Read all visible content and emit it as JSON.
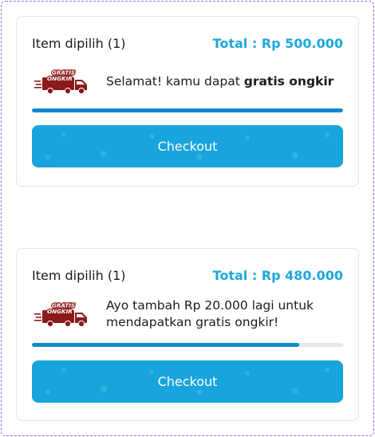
{
  "cards": [
    {
      "item_label": "Item dipilih (1)",
      "total": "Total : Rp 500.000",
      "badge": {
        "line1": "GRATIS",
        "line2": "ONGKIR",
        "icon": "delivery-truck-icon"
      },
      "message_plain": "Selamat! kamu dapat ",
      "message_bold": "gratis ongkir",
      "progress": 1.0,
      "checkout_label": "Checkout"
    },
    {
      "item_label": "Item dipilih (1)",
      "total": "Total : Rp 480.000",
      "badge": {
        "line1": "GRATIS",
        "line2": "ONGKIR",
        "icon": "delivery-truck-icon"
      },
      "message_plain": "Ayo tambah Rp 20.000 lagi untuk mendapatkan gratis ongkir!",
      "message_bold": "",
      "progress": 0.86,
      "checkout_label": "Checkout"
    }
  ],
  "colors": {
    "accent": "#1ea7dd",
    "button": "#18a4dc",
    "progress_fill": "#1188d0",
    "progress_track": "#e8e8e8",
    "badge_red": "#8b1a1a",
    "frame_dash": "#9b6ae0"
  }
}
